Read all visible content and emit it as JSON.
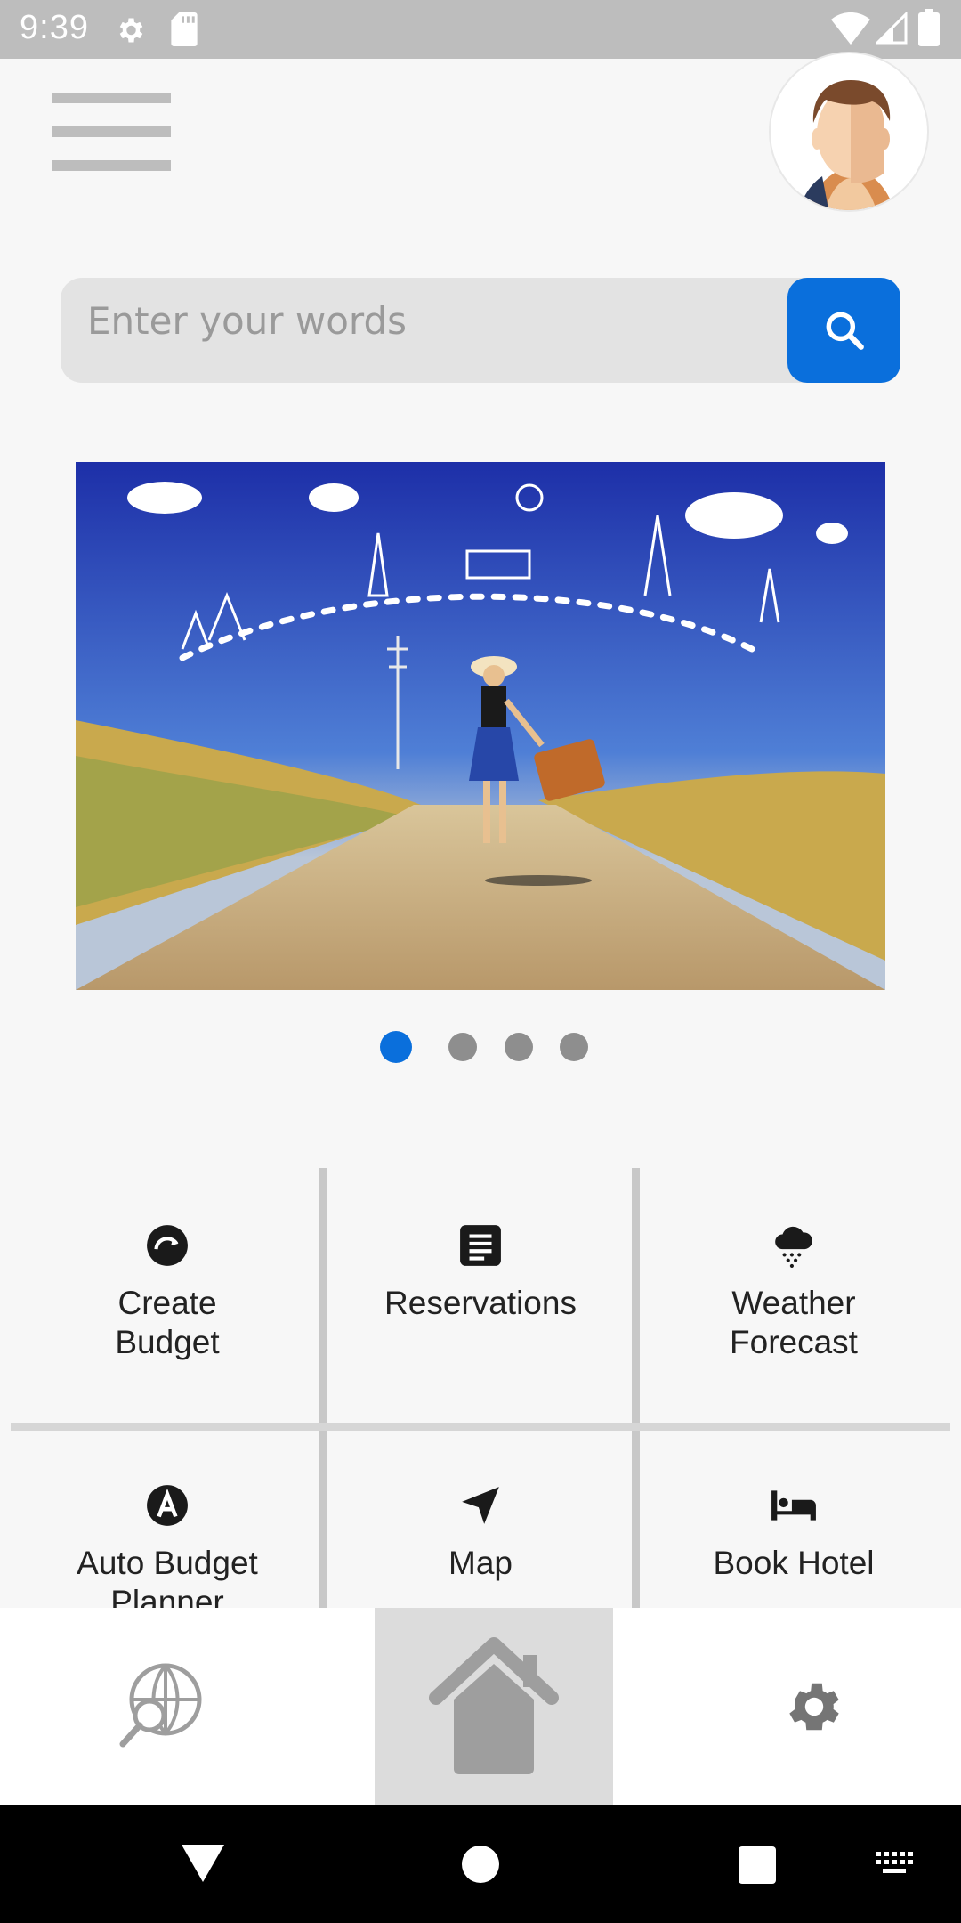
{
  "status_bar": {
    "time": "9:39",
    "icons": [
      "settings-icon",
      "sd-card-icon",
      "wifi-icon",
      "signal-icon",
      "battery-icon"
    ]
  },
  "header": {
    "menu_icon": "hamburger-menu-icon",
    "avatar": "user-avatar"
  },
  "search": {
    "placeholder": "Enter your words",
    "button_icon": "search-icon"
  },
  "carousel": {
    "slide_count": 4,
    "active_index": 0
  },
  "features": [
    {
      "label": "Create\nBudget",
      "icon": "budget-icon"
    },
    {
      "label": "Reservations",
      "icon": "reservations-icon"
    },
    {
      "label": "Weather\nForecast",
      "icon": "weather-icon"
    },
    {
      "label": "Auto Budget\nPlanner",
      "icon": "auto-budget-icon"
    },
    {
      "label": "Map",
      "icon": "navigation-icon"
    },
    {
      "label": "Book Hotel",
      "icon": "hotel-icon"
    }
  ],
  "bottom_nav": {
    "items": [
      "explore-globe-icon",
      "home-icon",
      "settings-icon"
    ],
    "active": "home"
  },
  "colors": {
    "accent": "#0a6fdc",
    "status_bar": "#bdbdbd",
    "divider": "#c8c8c8"
  }
}
